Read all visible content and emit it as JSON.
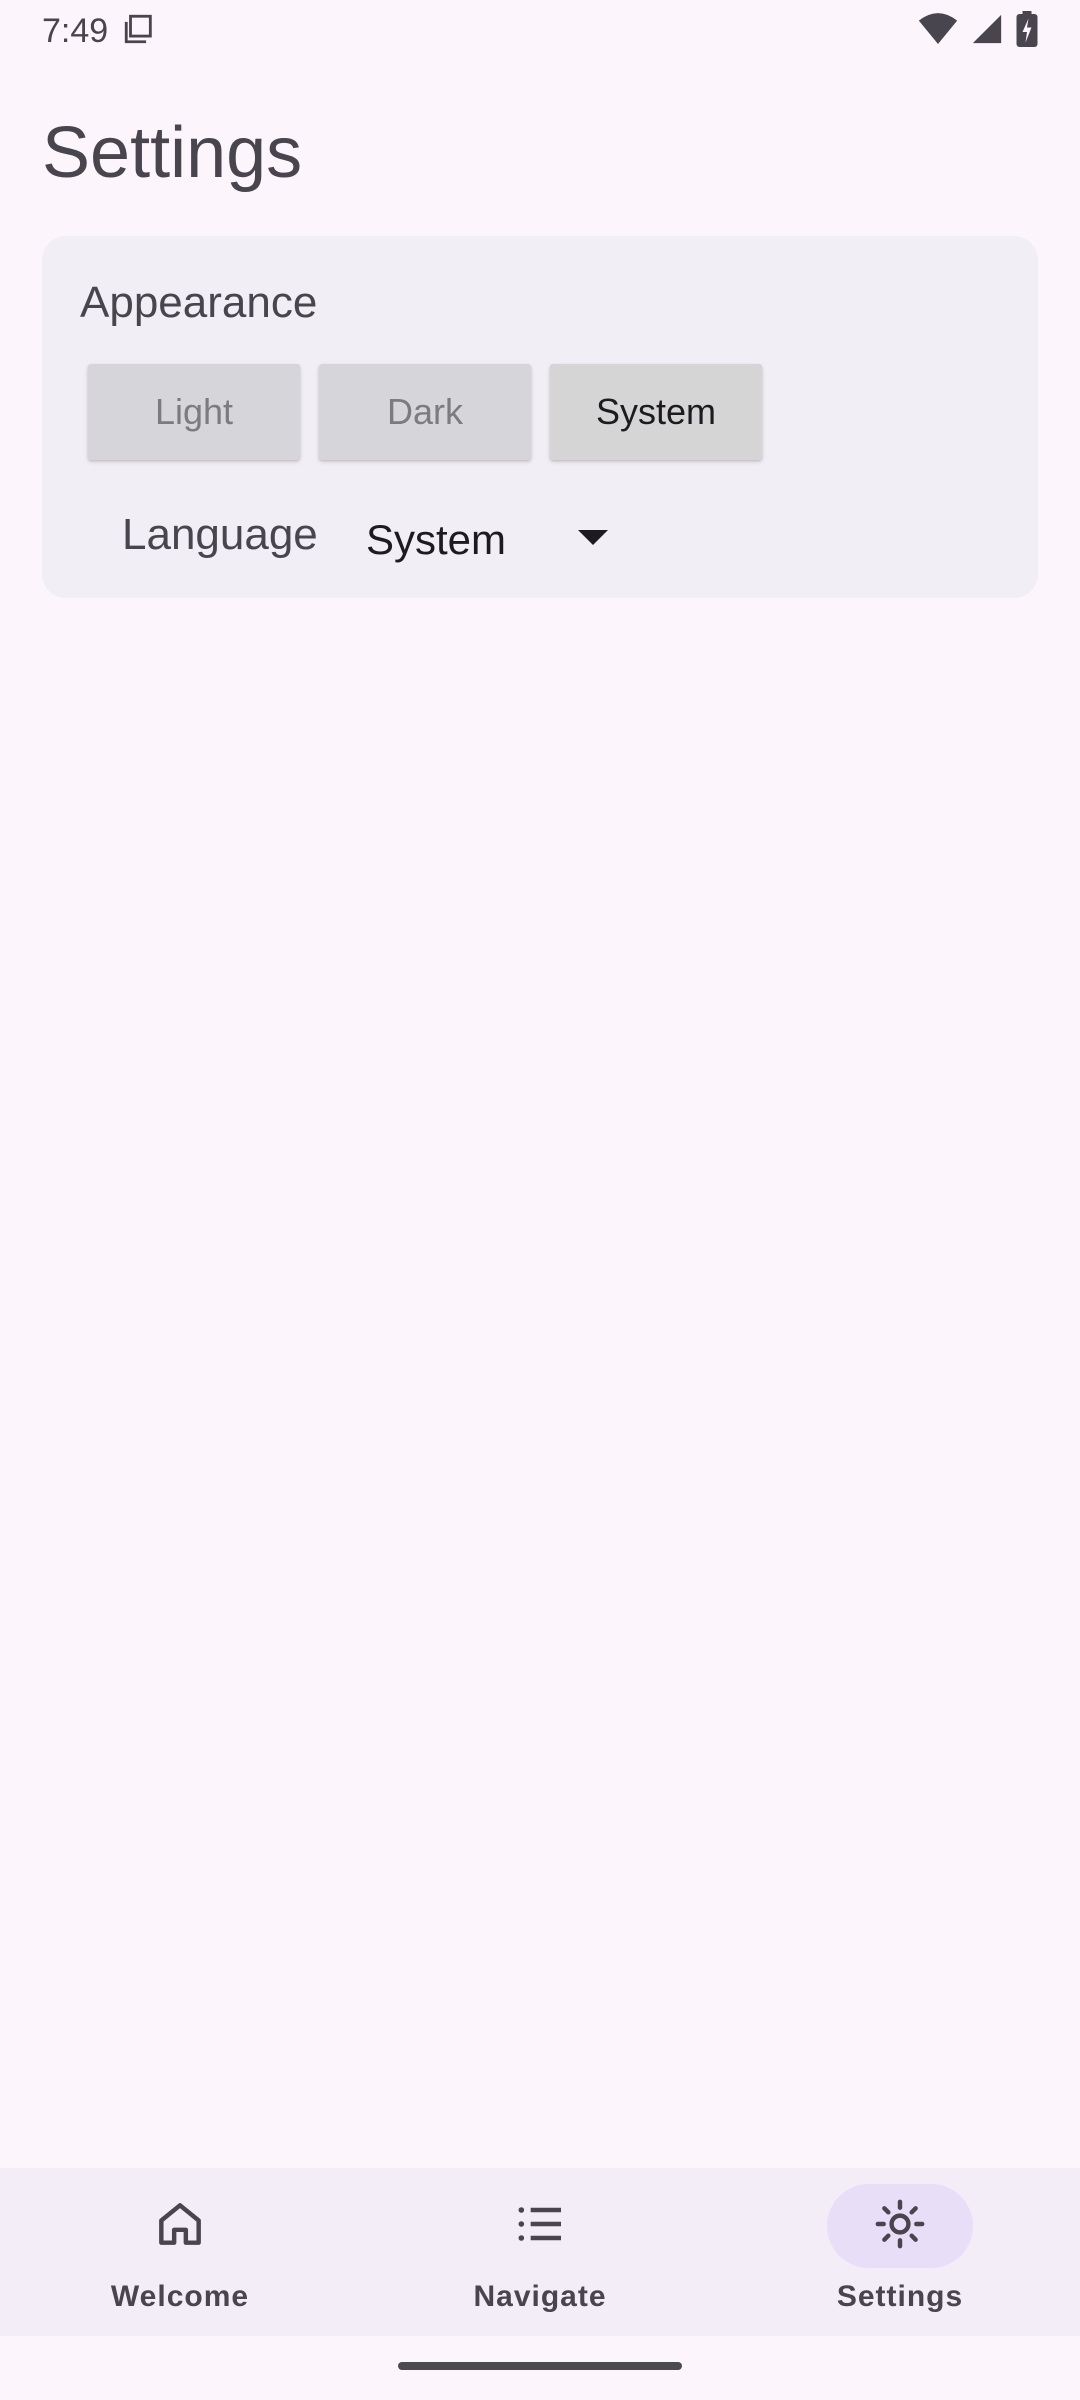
{
  "status": {
    "time": "7:49",
    "icons": [
      "screenshot-icon",
      "wifi-icon",
      "signal-icon",
      "battery-charging-icon"
    ]
  },
  "page": {
    "title": "Settings"
  },
  "appearance": {
    "title": "Appearance",
    "options": [
      "Light",
      "Dark",
      "System"
    ],
    "selected": "System"
  },
  "language": {
    "label": "Language",
    "value": "System"
  },
  "bottom_nav": {
    "items": [
      {
        "label": "Welcome",
        "icon": "home-icon"
      },
      {
        "label": "Navigate",
        "icon": "list-icon"
      },
      {
        "label": "Settings",
        "icon": "brightness-icon"
      }
    ],
    "active": "Settings"
  },
  "colors": {
    "background": "#FCF6FC",
    "card": "#F2EEF5",
    "nav_background": "#F2EDF6",
    "active_pill": "#E8DEF8",
    "text_secondary": "#49454F"
  }
}
